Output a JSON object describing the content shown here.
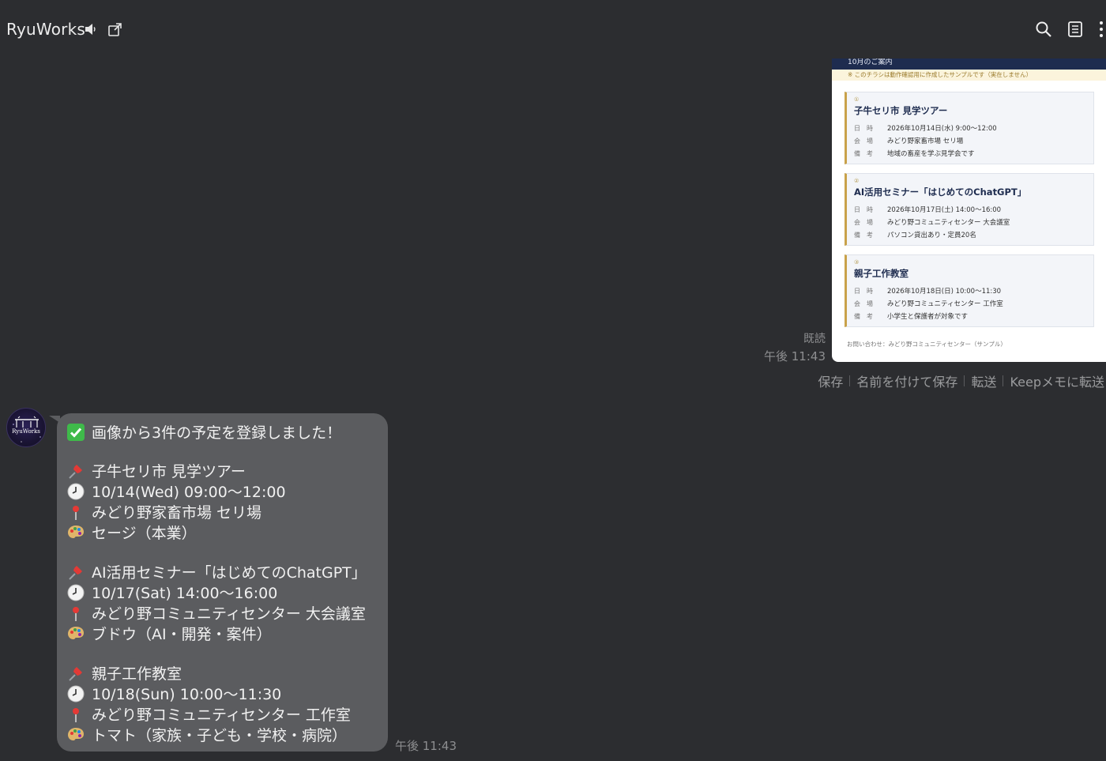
{
  "header": {
    "title": "RyuWorks",
    "icons": [
      "speaker-icon",
      "external-link-icon",
      "search-icon",
      "notes-icon",
      "more-vertical-icon"
    ]
  },
  "sent_image": {
    "top_banner": "10月のご案内",
    "note": "※ このチラシは動作確認用に作成したサンプルです（実在しません）",
    "events": [
      {
        "num": "①",
        "title": "子牛セリ市 見学ツアー",
        "rows": [
          {
            "label": "日　時",
            "value": "2026年10月14日(水)  9:00〜12:00"
          },
          {
            "label": "会　場",
            "value": "みどり野家畜市場 セリ場"
          },
          {
            "label": "備　考",
            "value": "地域の畜産を学ぶ見学会です"
          }
        ]
      },
      {
        "num": "②",
        "title": "AI活用セミナー「はじめてのChatGPT」",
        "rows": [
          {
            "label": "日　時",
            "value": "2026年10月17日(土)  14:00〜16:00"
          },
          {
            "label": "会　場",
            "value": "みどり野コミュニティセンター 大会議室"
          },
          {
            "label": "備　考",
            "value": "パソコン貸出あり・定員20名"
          }
        ]
      },
      {
        "num": "③",
        "title": "親子工作教室",
        "rows": [
          {
            "label": "日　時",
            "value": "2026年10月18日(日)  10:00〜11:30"
          },
          {
            "label": "会　場",
            "value": "みどり野コミュニティセンター 工作室"
          },
          {
            "label": "備　考",
            "value": "小学生と保護者が対象です"
          }
        ]
      }
    ],
    "footer": "お問い合わせ：みどり野コミュニティセンター（サンプル）",
    "read_label": "既読",
    "time": "午後 11:43"
  },
  "actions": [
    "保存",
    "名前を付けて保存",
    "転送",
    "Keepメモに転送"
  ],
  "avatar": {
    "text": "RyuWorks"
  },
  "reply": {
    "lines": [
      {
        "icon": "check-icon",
        "text": "画像から3件の予定を登録しました！"
      },
      {
        "icon": "pin-icon",
        "text": "子牛セリ市 見学ツアー"
      },
      {
        "icon": "clock-icon",
        "text": "10/14(Wed) 09:00〜12:00"
      },
      {
        "icon": "location-icon",
        "text": "みどり野家畜市場 セリ場"
      },
      {
        "icon": "palette-icon",
        "text": "セージ（本業）"
      },
      {
        "icon": "pin-icon",
        "text": "AI活用セミナー「はじめてのChatGPT」"
      },
      {
        "icon": "clock-icon",
        "text": "10/17(Sat) 14:00〜16:00"
      },
      {
        "icon": "location-icon",
        "text": "みどり野コミュニティセンター 大会議室"
      },
      {
        "icon": "palette-icon",
        "text": "ブドウ（AI・開発・案件）"
      },
      {
        "icon": "pin-icon",
        "text": "親子工作教室"
      },
      {
        "icon": "clock-icon",
        "text": "10/18(Sun) 10:00〜11:30"
      },
      {
        "icon": "location-icon",
        "text": "みどり野コミュニティセンター 工作室"
      },
      {
        "icon": "palette-icon",
        "text": "トマト（家族・子ども・学校・病院）"
      }
    ],
    "time": "午後 11:43"
  }
}
